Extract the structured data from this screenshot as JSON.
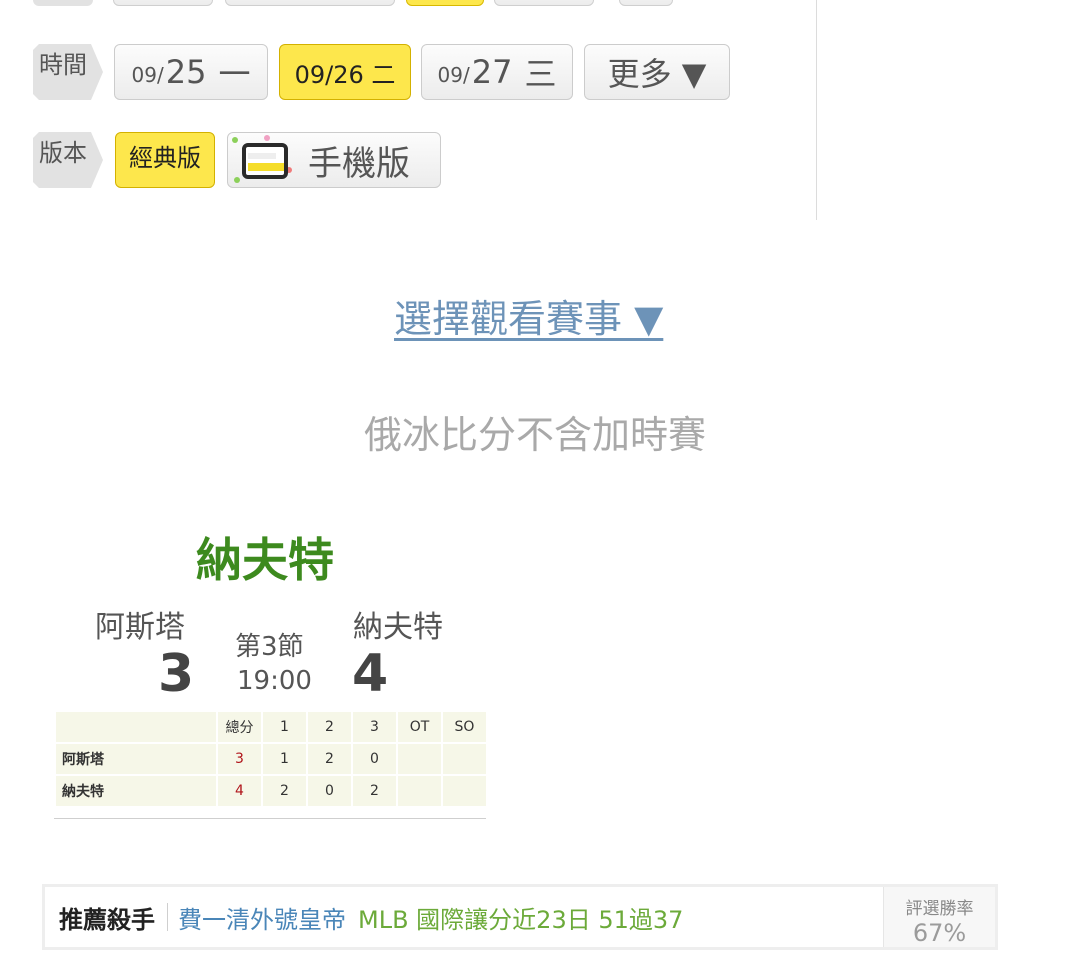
{
  "filters": {
    "time": {
      "label": "時間",
      "dates": [
        {
          "month": "09/",
          "day": "25",
          "weekday": "一",
          "selected": false
        },
        {
          "full": "09/26 二",
          "selected": true
        },
        {
          "month": "09/",
          "day": "27",
          "weekday": "三",
          "selected": false
        }
      ],
      "more_label": "更多 ▼"
    },
    "version": {
      "label": "版本",
      "classic_label": "經典版",
      "mobile_label": "手機版"
    }
  },
  "select_event_link": "選擇觀看賽事 ▼",
  "note": "俄冰比分不含加時賽",
  "game": {
    "title": "納夫特",
    "away_team": "阿斯塔",
    "home_team": "納夫特",
    "away_score": "3",
    "home_score": "4",
    "period": "第3節",
    "time": "19:00",
    "boxscore": {
      "headers": [
        "",
        "總分",
        "1",
        "2",
        "3",
        "OT",
        "SO"
      ],
      "rows": [
        {
          "team": "阿斯塔",
          "total": "3",
          "p1": "1",
          "p2": "2",
          "p3": "0",
          "ot": "",
          "so": ""
        },
        {
          "team": "納夫特",
          "total": "4",
          "p1": "2",
          "p2": "0",
          "p3": "2",
          "ot": "",
          "so": ""
        }
      ]
    }
  },
  "banner": {
    "title": "推薦殺手",
    "user": "費一清外號皇帝",
    "record": "MLB 國際讓分近23日 51過37",
    "rate_label": "評選勝率",
    "rate_value": "67%"
  },
  "colors": {
    "selected_yellow": "#fde74c",
    "team_green": "#3d8a1e",
    "link_blue": "#6d93b8",
    "total_red": "#b0141a"
  }
}
